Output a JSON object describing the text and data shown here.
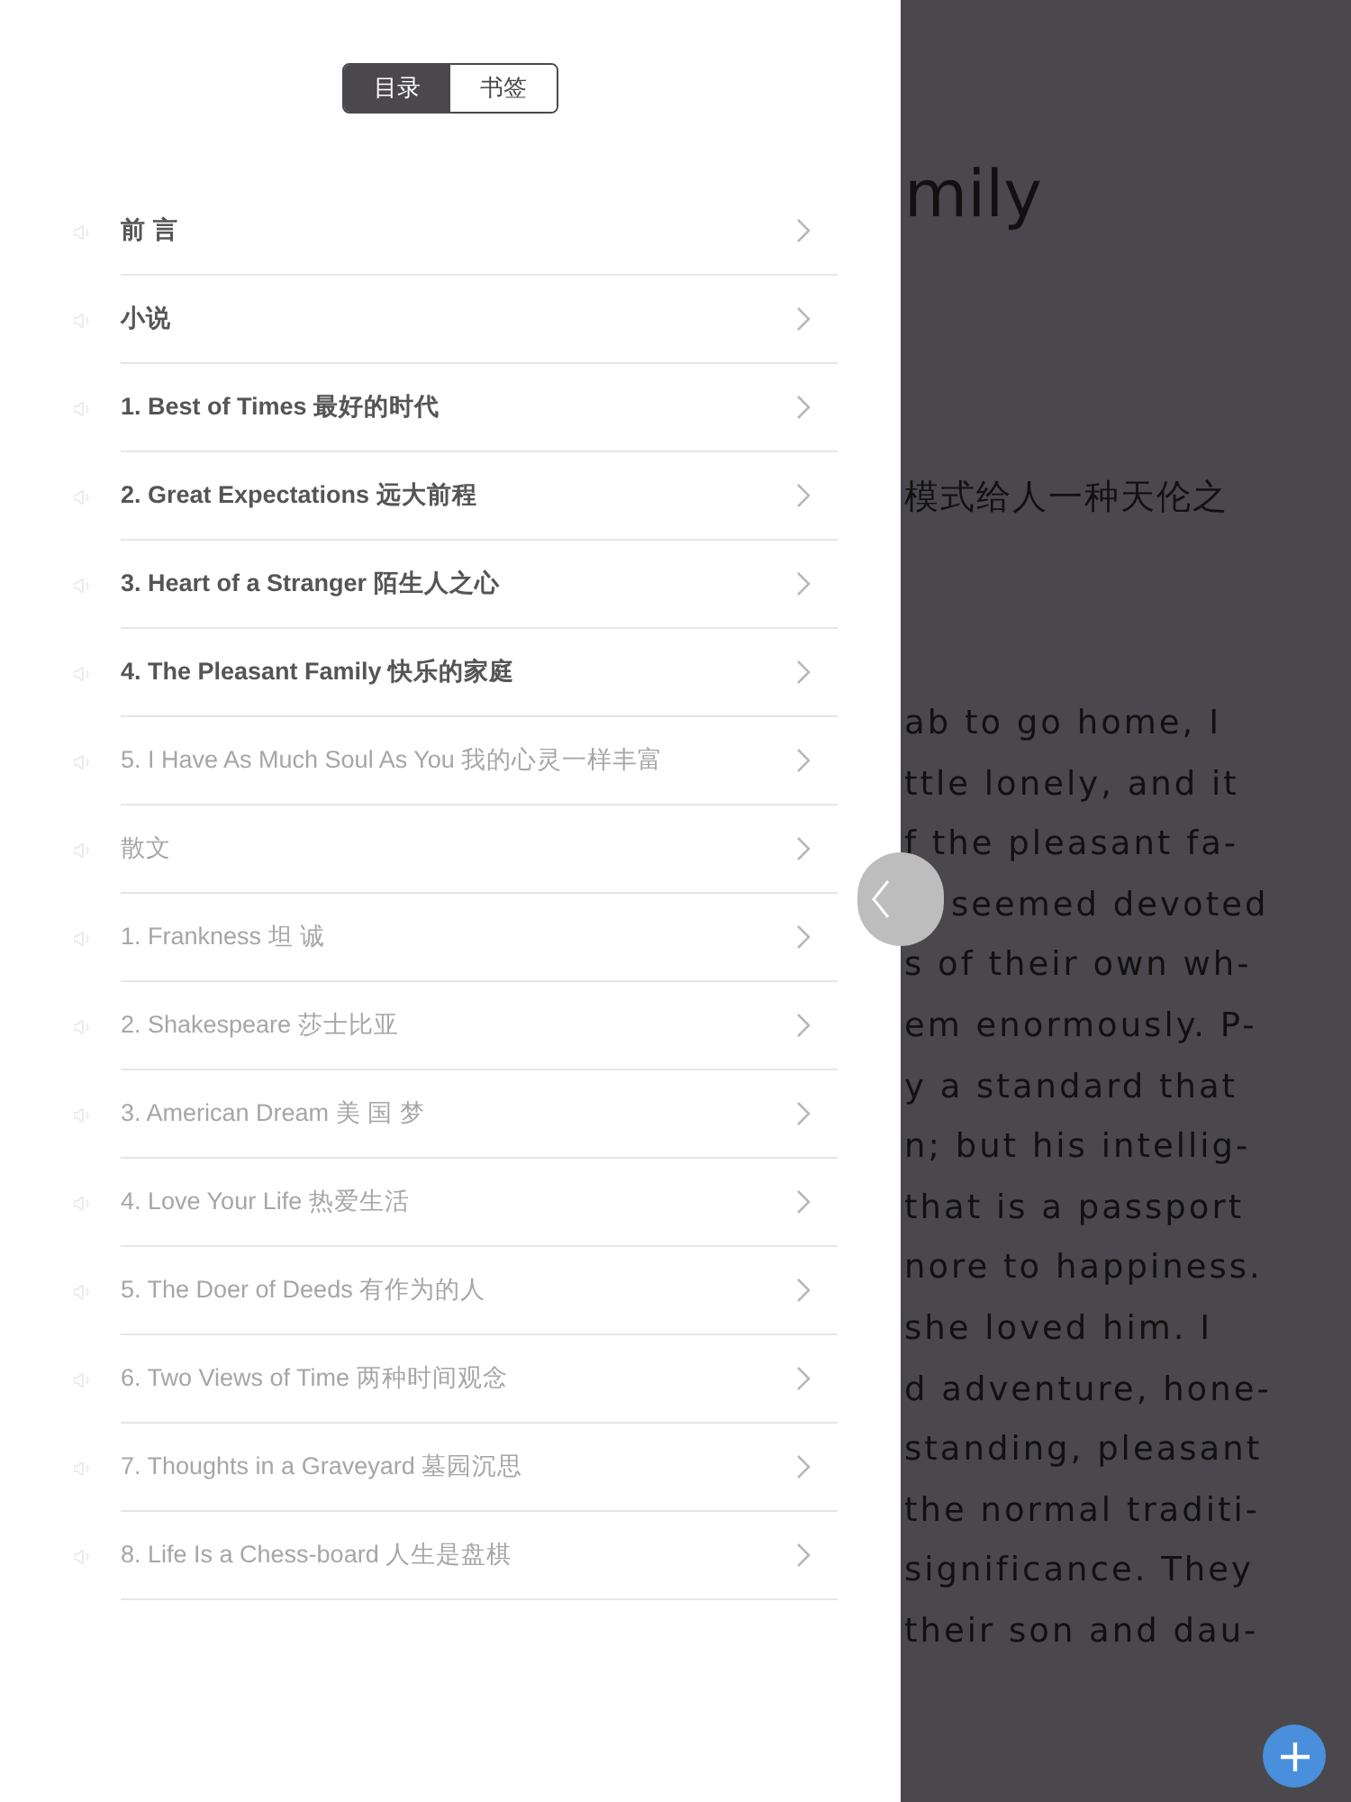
{
  "toc_panel": {
    "tabs": [
      {
        "label": "目录",
        "selected": true
      },
      {
        "label": "书签",
        "selected": false
      }
    ],
    "chapters": [
      {
        "title": "前 言",
        "disabled": false
      },
      {
        "title": "小说",
        "disabled": false
      },
      {
        "title": "1. Best of Times 最好的时代",
        "disabled": false
      },
      {
        "title": "2. Great Expectations 远大前程",
        "disabled": false
      },
      {
        "title": "3. Heart of a Stranger 陌生人之心",
        "disabled": false
      },
      {
        "title": "4. The Pleasant Family 快乐的家庭",
        "disabled": false
      },
      {
        "title": "5. I Have As Much Soul As You 我的心灵一样丰富",
        "disabled": true
      },
      {
        "title": "散文",
        "disabled": true
      },
      {
        "title": "1. Frankness 坦 诚",
        "disabled": true
      },
      {
        "title": "2. Shakespeare 莎士比亚",
        "disabled": true
      },
      {
        "title": "3. American Dream 美 国 梦",
        "disabled": true
      },
      {
        "title": "4. Love Your Life 热爱生活",
        "disabled": true
      },
      {
        "title": "5. The Doer of Deeds 有作为的人",
        "disabled": true
      },
      {
        "title": "6. Two Views of Time 两种时间观念",
        "disabled": true
      },
      {
        "title": "7. Thoughts in a Graveyard 墓园沉思",
        "disabled": true
      },
      {
        "title": "8. Life Is a Chess-board 人生是盘棋",
        "disabled": true
      }
    ]
  },
  "reader": {
    "title": "mily",
    "subtitle": "模式给人一种天伦之",
    "lines": [
      "ab to go home, I",
      "ttle lonely, and it",
      "f the pleasant fa-",
      "seemed devoted",
      "s of their own wh-",
      "em enormously. P-",
      "y a standard that",
      "n; but his intellig-",
      "that is a passport",
      "nore to happiness.",
      "she loved him. I",
      "d adventure, hone-",
      "standing, pleasant",
      "the normal traditi-",
      "significance. They",
      "their son and dau-"
    ]
  }
}
